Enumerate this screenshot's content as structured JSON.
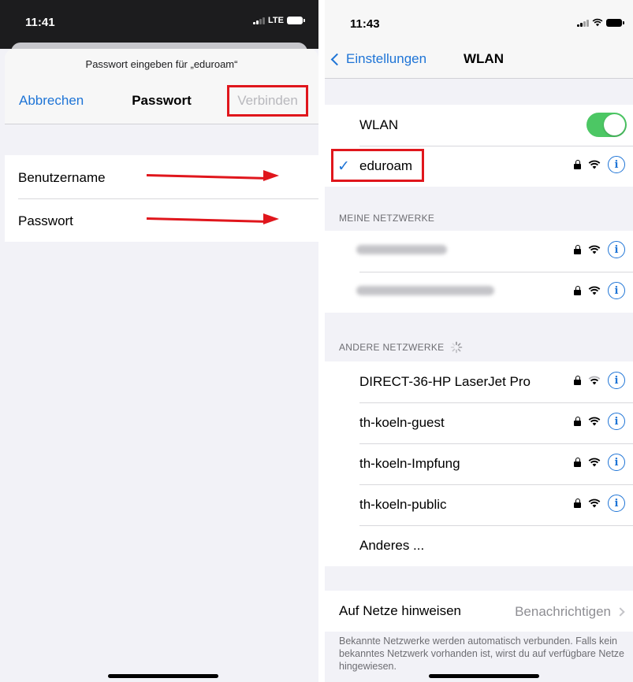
{
  "left": {
    "status": {
      "time": "11:41",
      "network": "LTE"
    },
    "sheet": {
      "prompt": "Passwort eingeben für „eduroam“",
      "cancel_label": "Abbrechen",
      "title": "Passwort",
      "connect_label": "Verbinden"
    },
    "fields": [
      {
        "label": "Benutzername"
      },
      {
        "label": "Passwort"
      }
    ],
    "colors": {
      "accent": "#1e74d6",
      "highlight": "#e0161c",
      "disabled": "#b8b8bd"
    }
  },
  "right": {
    "status": {
      "time": "11:43"
    },
    "nav": {
      "back_label": "Einstellungen",
      "title": "WLAN"
    },
    "wlan": {
      "toggle_label": "WLAN",
      "toggle_on": true,
      "connected_network": "eduroam"
    },
    "my_networks": {
      "header": "MEINE NETZWERKE"
    },
    "other_networks": {
      "header": "ANDERE NETZWERKE",
      "items": [
        {
          "name": "DIRECT-36-HP LaserJet Pro"
        },
        {
          "name": "th-koeln-guest"
        },
        {
          "name": "th-koeln-Impfung"
        },
        {
          "name": "th-koeln-public"
        }
      ],
      "other_label": "Anderes ..."
    },
    "ask_to_join": {
      "label": "Auf Netze hinweisen",
      "value": "Benachrichtigen"
    },
    "footnote": "Bekannte Netzwerke werden automatisch verbunden. Falls kein bekanntes Netzwerk vorhanden ist, wirst du auf verfügbare Netze hingewiesen.",
    "colors": {
      "accent": "#1e74d6",
      "toggle_on": "#4cc764",
      "highlight": "#e0161c"
    }
  }
}
